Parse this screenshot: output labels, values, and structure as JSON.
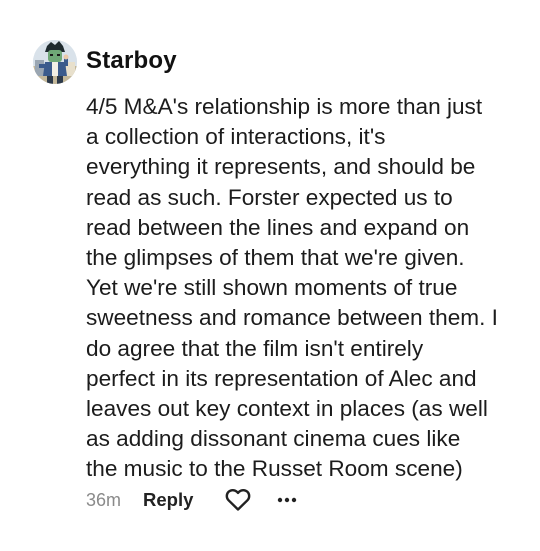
{
  "comment": {
    "username": "Starboy",
    "avatar_icon": "anime-character-avatar-icon",
    "body_lines": [
      "4/5 M&A's relationship is more than just",
      "a collection of interactions, it's",
      "everything it represents, and should be",
      "read as such. Forster expected us to",
      "read between the lines and expand on",
      "the glimpses of them that we're given.",
      "Yet we're still shown moments of true",
      "sweetness and romance between them. I",
      "do agree that the film isn't entirely",
      "perfect in its representation of Alec and",
      "leaves out key context in places (as well",
      "as adding dissonant cinema cues like",
      "the music to the Russet Room scene)"
    ],
    "timestamp": "36m",
    "reply_label": "Reply",
    "like_icon": "heart-outline-icon",
    "more_icon": "more-horizontal-icon"
  },
  "colors": {
    "text": "#1c1c1c",
    "muted": "#8a8a8a",
    "background": "#ffffff"
  }
}
